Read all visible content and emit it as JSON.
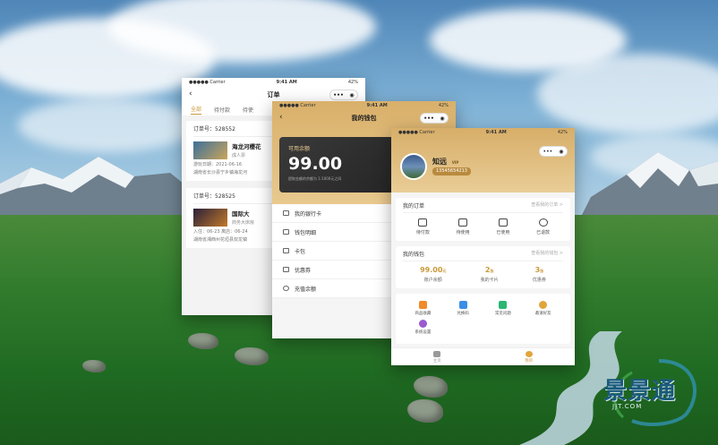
{
  "orders_screen": {
    "status": {
      "carrier": "●●●●● Carrier",
      "time": "9:41 AM",
      "battery": "42%"
    },
    "title": "订单",
    "tabs": [
      "全部",
      "待付款",
      "待使"
    ],
    "orders": [
      {
        "number": "订单号：528552",
        "name": "海龙河樱花",
        "type": "成人票",
        "line1": "游玩日期：2021-06-16",
        "line2": "湖南省长沙县宁乡镇海龙河"
      },
      {
        "number": "订单号：528525",
        "name": "国际大",
        "type": "商务大床房",
        "line1": "入住：06-23  离店：06-24",
        "line2": "湖南省湘西州花垣县双龙镇"
      }
    ]
  },
  "wallet_screen": {
    "status": {
      "carrier": "●●●●● Carrier",
      "time": "9:41 AM",
      "battery": "42%"
    },
    "title": "我的钱包",
    "balance_label": "可用余额",
    "balance_value": "99.00",
    "balance_note": "提取金额的余额为 1:1000元之间",
    "menu": [
      "我的银行卡",
      "钱包明细",
      "卡包",
      "优惠券",
      "充值余额"
    ]
  },
  "profile_screen": {
    "status": {
      "carrier": "●●●●● Carrier",
      "time": "9:41 AM",
      "battery": "42%"
    },
    "username": "知远",
    "vip": "VIP",
    "phone": "13545654213",
    "orders_section": {
      "title": "我的订单",
      "more": "查看我的订单 >",
      "items": [
        "待付款",
        "待使用",
        "已使用",
        "已退款"
      ]
    },
    "wallet_section": {
      "title": "我的钱包",
      "more": "查看我的钱包 >",
      "stats": [
        {
          "value": "99.00",
          "unit": "元",
          "label": "账户余额"
        },
        {
          "value": "2",
          "unit": "张",
          "label": "我的卡片"
        },
        {
          "value": "3",
          "unit": "张",
          "label": "优惠券"
        }
      ]
    },
    "tools": [
      "商品收藏",
      "兑换码",
      "常见问题",
      "邀请好友",
      "系统设置"
    ],
    "tool_colors": [
      "#f08a2a",
      "#3a8ee6",
      "#2bb673",
      "#e1a53a",
      "#9b59d0"
    ],
    "tabbar": [
      "主页",
      "我的"
    ]
  },
  "watermark": {
    "brand": "景景通",
    "url": "JJT.COM"
  }
}
